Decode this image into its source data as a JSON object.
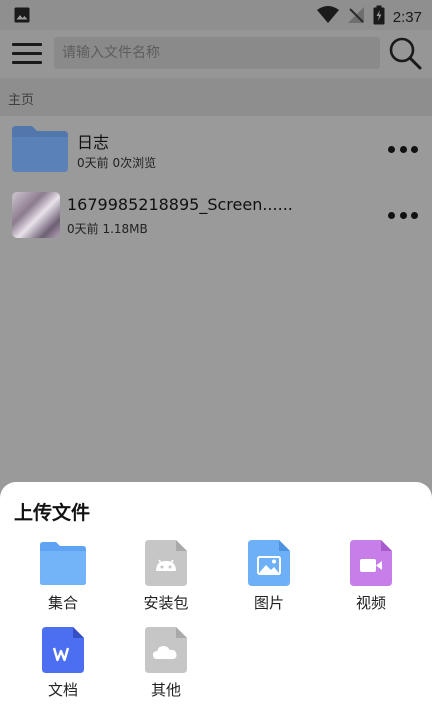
{
  "status_bar": {
    "time": "2:37"
  },
  "toolbar": {
    "search_placeholder": "请输入文件名称"
  },
  "breadcrumb": "主页",
  "files": [
    {
      "name": "日志",
      "meta": "0天前 0次浏览",
      "type": "folder"
    },
    {
      "name": "1679985218895_Screen......",
      "meta": "0天前 1.18MB",
      "type": "image"
    }
  ],
  "upload_sheet": {
    "title": "上传文件",
    "options": [
      {
        "label": "集合",
        "icon": "folder-icon",
        "color": "#6aaef8"
      },
      {
        "label": "安装包",
        "icon": "android-icon",
        "color": "#c9c9c9"
      },
      {
        "label": "图片",
        "icon": "image-icon",
        "color": "#6aaef8"
      },
      {
        "label": "视频",
        "icon": "video-icon",
        "color": "#c07de8"
      },
      {
        "label": "文档",
        "icon": "word-doc-icon",
        "color": "#4a6ef0"
      },
      {
        "label": "其他",
        "icon": "cloud-icon",
        "color": "#c9c9c9"
      }
    ]
  }
}
